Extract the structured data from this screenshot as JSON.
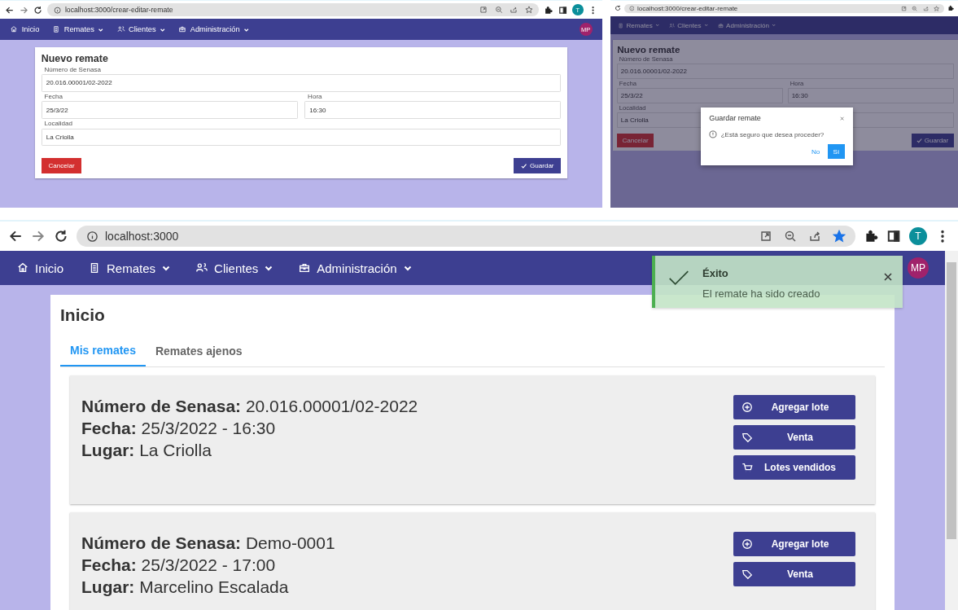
{
  "form_screen": {
    "browser": {
      "url": "localhost:3000/crear-editar-remate",
      "back_buttons": true,
      "bookmarked": false,
      "profile": "T"
    },
    "nav": {
      "items": [
        {
          "label": "Inicio",
          "kind": "home",
          "dropdown": false
        },
        {
          "label": "Remates",
          "kind": "book",
          "dropdown": true
        },
        {
          "label": "Clientes",
          "kind": "people",
          "dropdown": true
        },
        {
          "label": "Administración",
          "kind": "briefcase",
          "dropdown": true
        }
      ],
      "avatar": "MP"
    },
    "form": {
      "title": "Nuevo remate",
      "rows": [
        [
          {
            "label": "Número de Senasa",
            "value": "20.016.00001/02-2022"
          }
        ],
        [
          {
            "label": "Fecha",
            "value": "25/3/22"
          },
          {
            "label": "Hora",
            "value": "16:30"
          }
        ],
        [
          {
            "label": "Localidad",
            "value": "La Criolla"
          }
        ]
      ],
      "cancel": "Cancelar",
      "save": "Guardar"
    }
  },
  "dialog_screen": {
    "browser": {
      "url": "localhost:3000/crear-editar-remate",
      "back_buttons": false,
      "bookmarked": false
    },
    "nav": {
      "items": [
        {
          "label": "Remates",
          "kind": "book",
          "dropdown": true
        },
        {
          "label": "Clientes",
          "kind": "people",
          "dropdown": true
        },
        {
          "label": "Administración",
          "kind": "briefcase",
          "dropdown": true
        }
      ]
    },
    "form": {
      "title": "Nuevo remate",
      "rows": [
        [
          {
            "label": "Número de Senasa",
            "value": "20.016.00001/02-2022"
          }
        ],
        [
          {
            "label": "Fecha",
            "value": "25/3/22"
          },
          {
            "label": "Hora",
            "value": "16:30"
          }
        ],
        [
          {
            "label": "Localidad",
            "value": "La Criolla"
          }
        ]
      ],
      "cancel": "Cancelar",
      "save": "Guardar"
    },
    "dialog": {
      "title": "Guardar remate",
      "message": "¿Está seguro que desea proceder?",
      "buttons": [
        {
          "label": "No",
          "primary": false
        },
        {
          "label": "Sí",
          "primary": true
        }
      ]
    }
  },
  "home_screen": {
    "browser": {
      "url": "localhost:3000",
      "back_buttons": true,
      "bookmarked": true,
      "profile": "T"
    },
    "nav": {
      "items": [
        {
          "label": "Inicio",
          "kind": "home",
          "dropdown": false
        },
        {
          "label": "Remates",
          "kind": "book",
          "dropdown": true
        },
        {
          "label": "Clientes",
          "kind": "people",
          "dropdown": true
        },
        {
          "label": "Administración",
          "kind": "briefcase",
          "dropdown": true
        }
      ],
      "avatar": "MP"
    },
    "page": {
      "title": "Inicio",
      "tabs": [
        {
          "label": "Mis remates",
          "selected": true
        },
        {
          "label": "Remates ajenos",
          "selected": false
        }
      ],
      "remates": [
        {
          "lines": [
            "**Número de Senasa:** 20.016.00001/02-2022",
            "**Fecha:** 25/3/2022 - 16:30",
            "**Lugar:** La Criolla"
          ],
          "actions": [
            {
              "label": "Agregar lote",
              "kind": "add"
            },
            {
              "label": "Venta",
              "kind": "tag"
            },
            {
              "label": "Lotes vendidos",
              "kind": "cart"
            }
          ]
        },
        {
          "lines": [
            "**Número de Senasa:** Demo-0001",
            "**Fecha:** 25/3/2022 - 17:00",
            "**Lugar:** Marcelino Escalada"
          ],
          "actions": [
            {
              "label": "Agregar lote",
              "kind": "add"
            },
            {
              "label": "Venta",
              "kind": "tag"
            }
          ]
        }
      ]
    },
    "toast": {
      "title": "Éxito",
      "message": "El remate ha sido creado"
    }
  }
}
